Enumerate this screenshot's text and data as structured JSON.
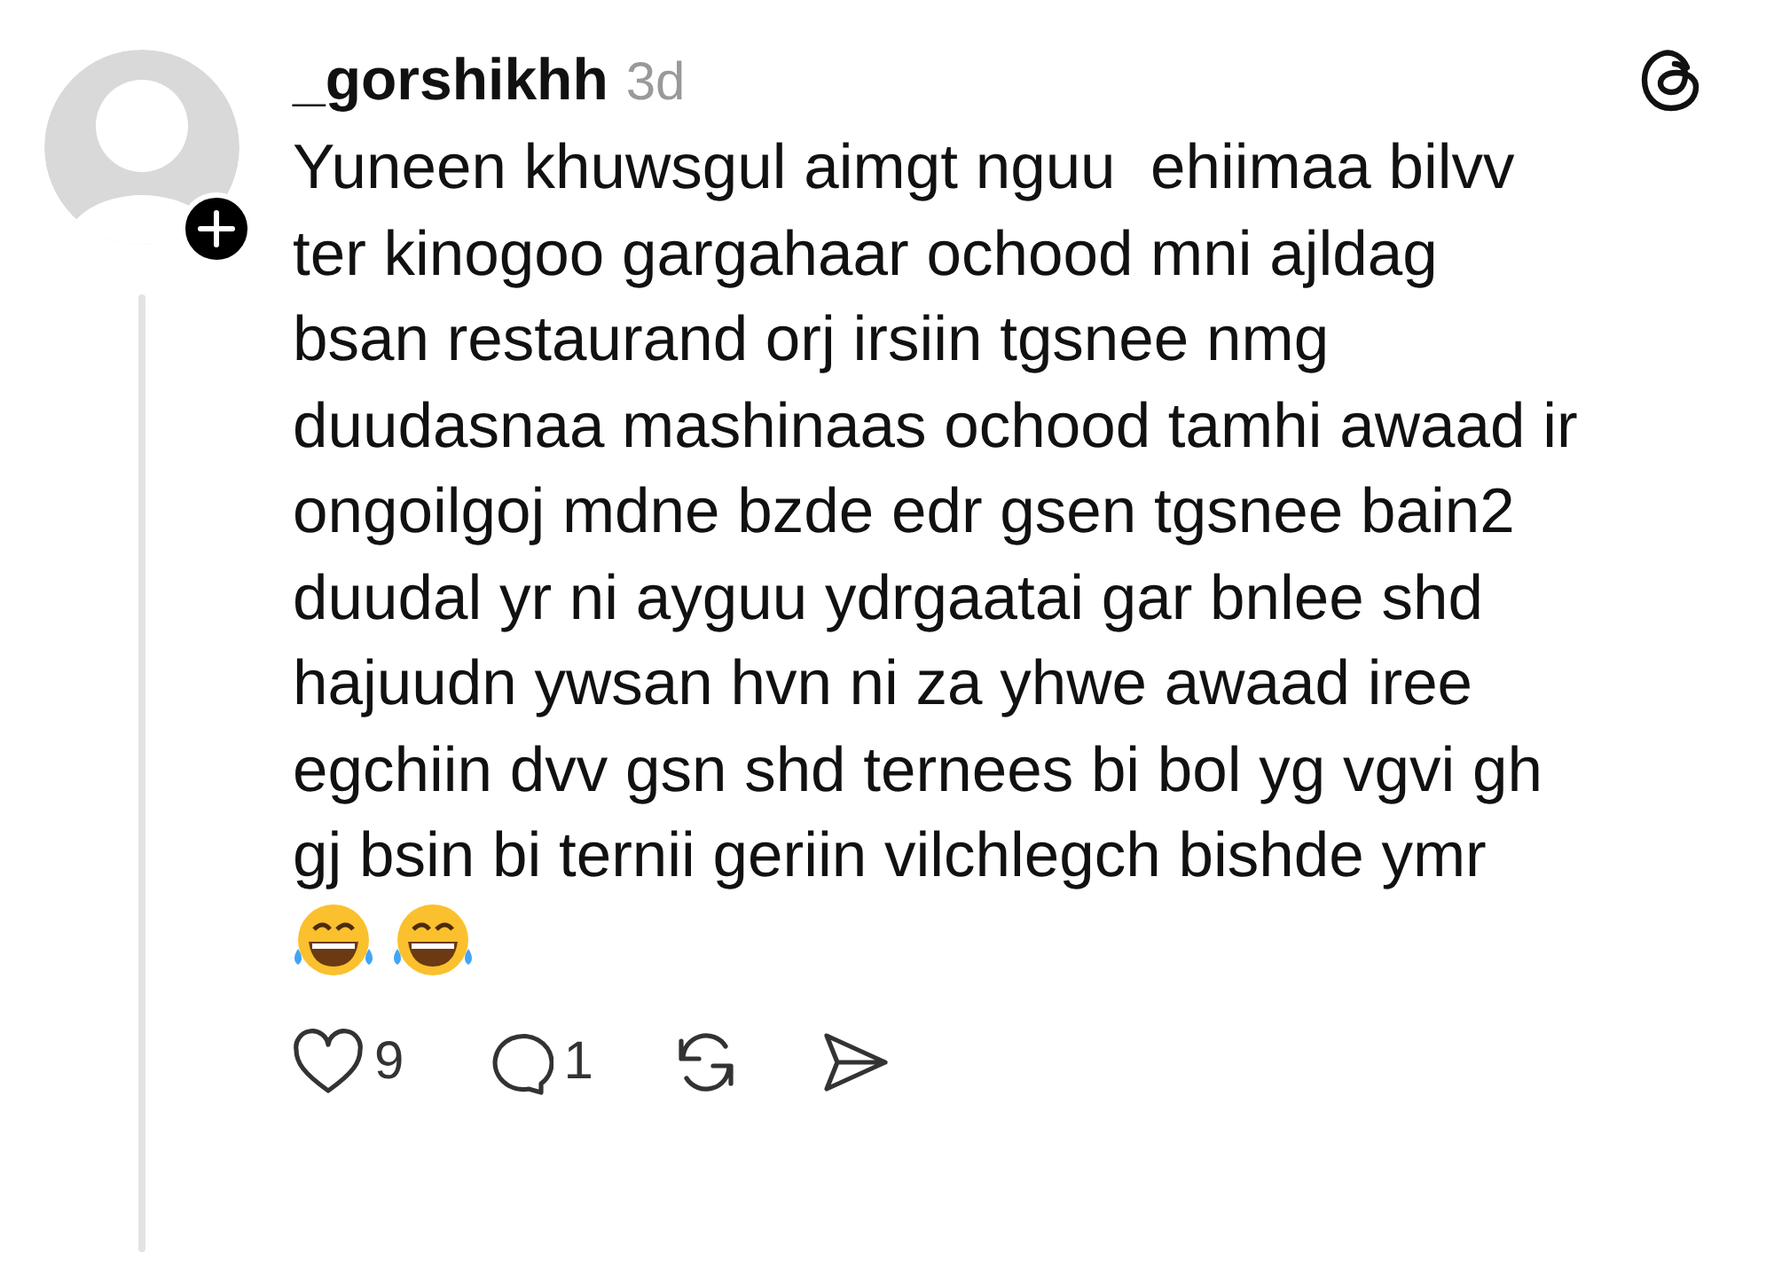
{
  "post": {
    "username": "_gorshikhh",
    "time": "3d",
    "lines": [
      "Yuneen khuwsgul aimgt nguu  ehiimaa bilvv",
      "ter kinogoo gargahaar ochood mni ajldag",
      "bsan restaurand orj irsiin tgsnee nmg",
      "duudasnaa mashinaas ochood tamhi awaad ir",
      "ongoilgoj mdne bzde edr gsen tgsnee bain2",
      "duudal yr ni ayguu ydrgaatai gar bnlee shd",
      "hajuudn ywsan hvn ni za yhwe awaad iree",
      "egchiin dvv gsn shd ternees bi bol yg vgvi gh",
      "gj bsin bi ternii geriin vilchlegch bishde ymr"
    ],
    "emojis": [
      {
        "kind": "tears-of-joy"
      },
      {
        "kind": "tears-of-joy"
      }
    ],
    "actions": [
      {
        "kind": "like",
        "count": "9"
      },
      {
        "kind": "reply",
        "count": "1"
      },
      {
        "kind": "repost"
      },
      {
        "kind": "share"
      }
    ]
  }
}
